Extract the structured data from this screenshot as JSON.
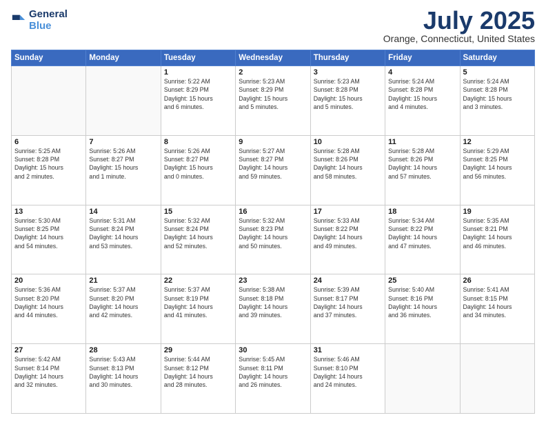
{
  "header": {
    "logo_line1": "General",
    "logo_line2": "Blue",
    "month_year": "July 2025",
    "location": "Orange, Connecticut, United States"
  },
  "days_of_week": [
    "Sunday",
    "Monday",
    "Tuesday",
    "Wednesday",
    "Thursday",
    "Friday",
    "Saturday"
  ],
  "weeks": [
    [
      {
        "day": "",
        "info": ""
      },
      {
        "day": "",
        "info": ""
      },
      {
        "day": "1",
        "info": "Sunrise: 5:22 AM\nSunset: 8:29 PM\nDaylight: 15 hours\nand 6 minutes."
      },
      {
        "day": "2",
        "info": "Sunrise: 5:23 AM\nSunset: 8:29 PM\nDaylight: 15 hours\nand 5 minutes."
      },
      {
        "day": "3",
        "info": "Sunrise: 5:23 AM\nSunset: 8:28 PM\nDaylight: 15 hours\nand 5 minutes."
      },
      {
        "day": "4",
        "info": "Sunrise: 5:24 AM\nSunset: 8:28 PM\nDaylight: 15 hours\nand 4 minutes."
      },
      {
        "day": "5",
        "info": "Sunrise: 5:24 AM\nSunset: 8:28 PM\nDaylight: 15 hours\nand 3 minutes."
      }
    ],
    [
      {
        "day": "6",
        "info": "Sunrise: 5:25 AM\nSunset: 8:28 PM\nDaylight: 15 hours\nand 2 minutes."
      },
      {
        "day": "7",
        "info": "Sunrise: 5:26 AM\nSunset: 8:27 PM\nDaylight: 15 hours\nand 1 minute."
      },
      {
        "day": "8",
        "info": "Sunrise: 5:26 AM\nSunset: 8:27 PM\nDaylight: 15 hours\nand 0 minutes."
      },
      {
        "day": "9",
        "info": "Sunrise: 5:27 AM\nSunset: 8:27 PM\nDaylight: 14 hours\nand 59 minutes."
      },
      {
        "day": "10",
        "info": "Sunrise: 5:28 AM\nSunset: 8:26 PM\nDaylight: 14 hours\nand 58 minutes."
      },
      {
        "day": "11",
        "info": "Sunrise: 5:28 AM\nSunset: 8:26 PM\nDaylight: 14 hours\nand 57 minutes."
      },
      {
        "day": "12",
        "info": "Sunrise: 5:29 AM\nSunset: 8:25 PM\nDaylight: 14 hours\nand 56 minutes."
      }
    ],
    [
      {
        "day": "13",
        "info": "Sunrise: 5:30 AM\nSunset: 8:25 PM\nDaylight: 14 hours\nand 54 minutes."
      },
      {
        "day": "14",
        "info": "Sunrise: 5:31 AM\nSunset: 8:24 PM\nDaylight: 14 hours\nand 53 minutes."
      },
      {
        "day": "15",
        "info": "Sunrise: 5:32 AM\nSunset: 8:24 PM\nDaylight: 14 hours\nand 52 minutes."
      },
      {
        "day": "16",
        "info": "Sunrise: 5:32 AM\nSunset: 8:23 PM\nDaylight: 14 hours\nand 50 minutes."
      },
      {
        "day": "17",
        "info": "Sunrise: 5:33 AM\nSunset: 8:22 PM\nDaylight: 14 hours\nand 49 minutes."
      },
      {
        "day": "18",
        "info": "Sunrise: 5:34 AM\nSunset: 8:22 PM\nDaylight: 14 hours\nand 47 minutes."
      },
      {
        "day": "19",
        "info": "Sunrise: 5:35 AM\nSunset: 8:21 PM\nDaylight: 14 hours\nand 46 minutes."
      }
    ],
    [
      {
        "day": "20",
        "info": "Sunrise: 5:36 AM\nSunset: 8:20 PM\nDaylight: 14 hours\nand 44 minutes."
      },
      {
        "day": "21",
        "info": "Sunrise: 5:37 AM\nSunset: 8:20 PM\nDaylight: 14 hours\nand 42 minutes."
      },
      {
        "day": "22",
        "info": "Sunrise: 5:37 AM\nSunset: 8:19 PM\nDaylight: 14 hours\nand 41 minutes."
      },
      {
        "day": "23",
        "info": "Sunrise: 5:38 AM\nSunset: 8:18 PM\nDaylight: 14 hours\nand 39 minutes."
      },
      {
        "day": "24",
        "info": "Sunrise: 5:39 AM\nSunset: 8:17 PM\nDaylight: 14 hours\nand 37 minutes."
      },
      {
        "day": "25",
        "info": "Sunrise: 5:40 AM\nSunset: 8:16 PM\nDaylight: 14 hours\nand 36 minutes."
      },
      {
        "day": "26",
        "info": "Sunrise: 5:41 AM\nSunset: 8:15 PM\nDaylight: 14 hours\nand 34 minutes."
      }
    ],
    [
      {
        "day": "27",
        "info": "Sunrise: 5:42 AM\nSunset: 8:14 PM\nDaylight: 14 hours\nand 32 minutes."
      },
      {
        "day": "28",
        "info": "Sunrise: 5:43 AM\nSunset: 8:13 PM\nDaylight: 14 hours\nand 30 minutes."
      },
      {
        "day": "29",
        "info": "Sunrise: 5:44 AM\nSunset: 8:12 PM\nDaylight: 14 hours\nand 28 minutes."
      },
      {
        "day": "30",
        "info": "Sunrise: 5:45 AM\nSunset: 8:11 PM\nDaylight: 14 hours\nand 26 minutes."
      },
      {
        "day": "31",
        "info": "Sunrise: 5:46 AM\nSunset: 8:10 PM\nDaylight: 14 hours\nand 24 minutes."
      },
      {
        "day": "",
        "info": ""
      },
      {
        "day": "",
        "info": ""
      }
    ]
  ]
}
